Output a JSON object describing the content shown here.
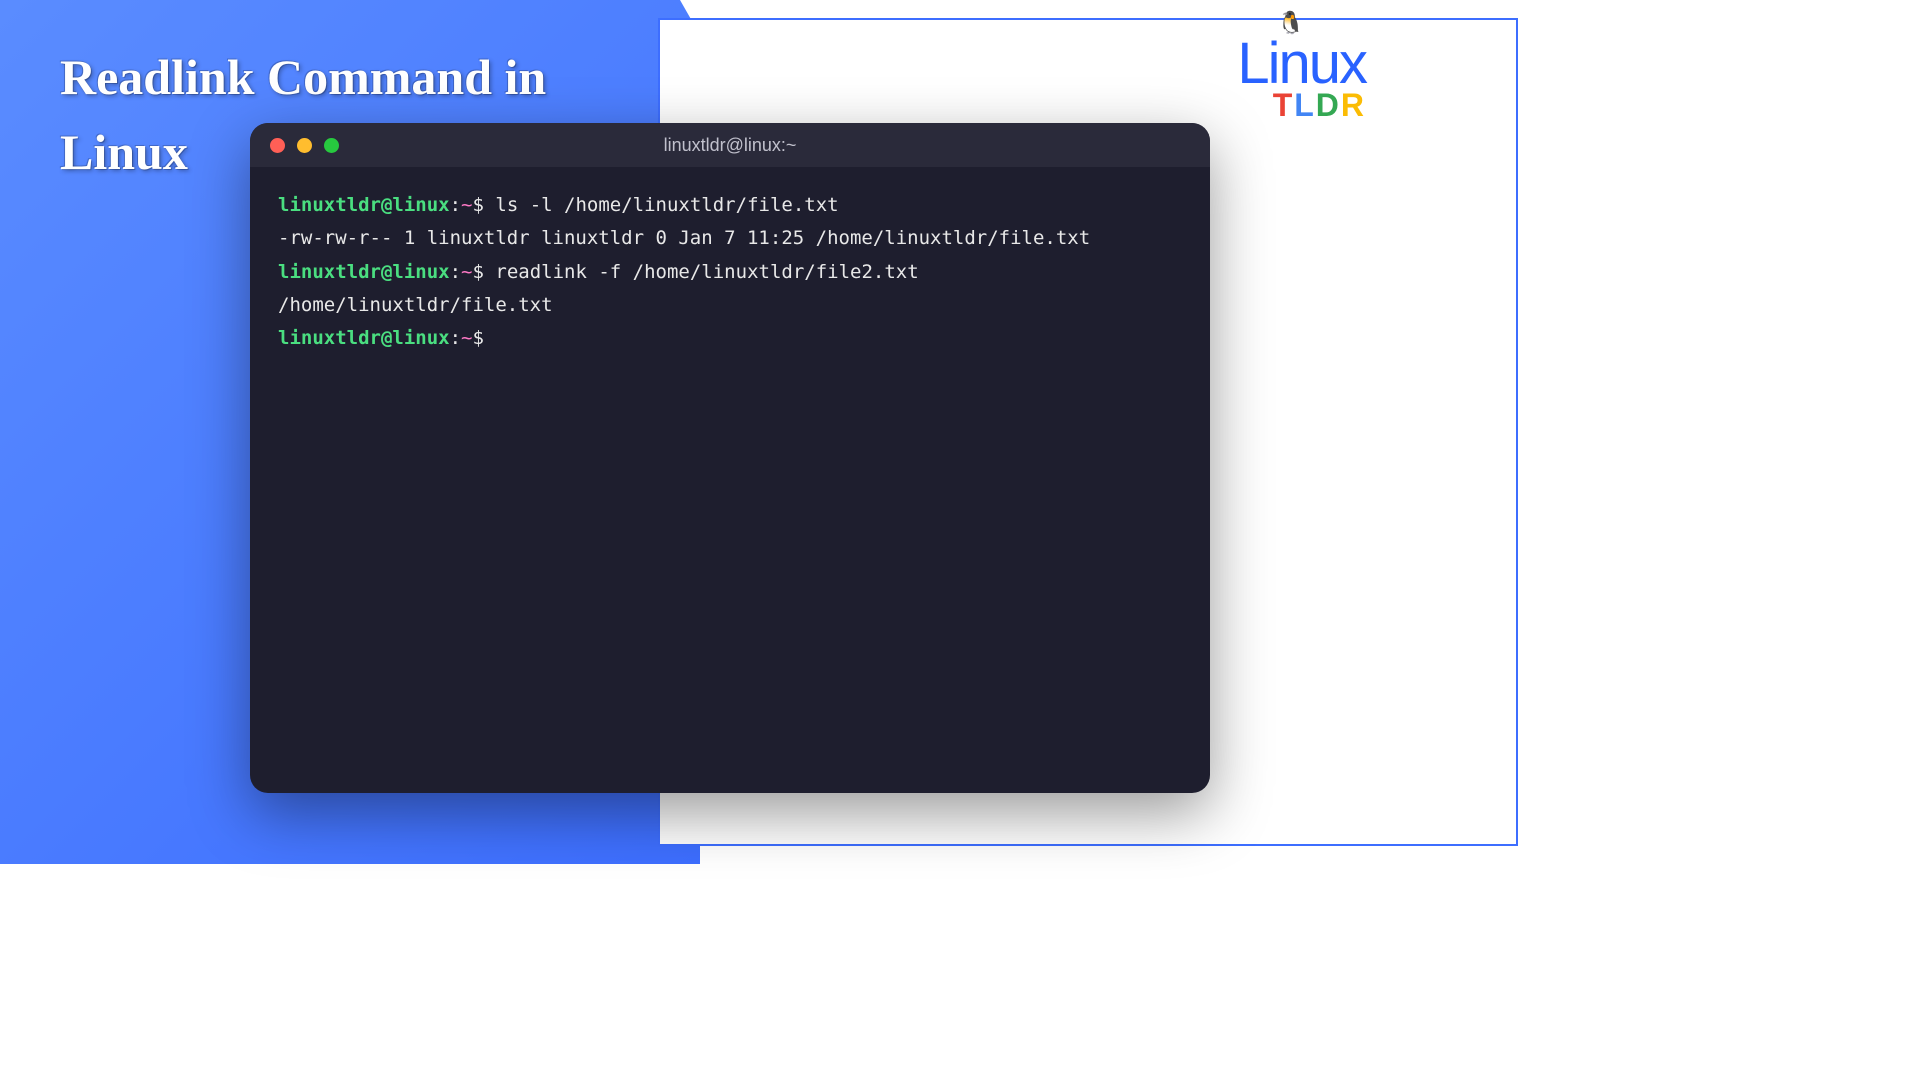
{
  "heading": {
    "line1": "Readlink Command in",
    "line2": "Linux"
  },
  "logo": {
    "main": "Linux",
    "sub_t": "T",
    "sub_l": "L",
    "sub_d": "D",
    "sub_r": "R",
    "penguin": "🐧"
  },
  "terminal": {
    "title": "linuxtldr@linux:~",
    "prompt": {
      "user": "linuxtldr@linux",
      "colon": ":",
      "path": "~",
      "dollar": "$"
    },
    "lines": [
      {
        "type": "command",
        "text": "ls -l /home/linuxtldr/file.txt"
      },
      {
        "type": "output",
        "text": "-rw-rw-r-- 1 linuxtldr linuxtldr 0 Jan  7 11:25 /home/linuxtldr/file.txt"
      },
      {
        "type": "command",
        "text": "readlink -f /home/linuxtldr/file2.txt"
      },
      {
        "type": "output",
        "text": "/home/linuxtldr/file.txt"
      },
      {
        "type": "command",
        "text": ""
      }
    ]
  }
}
